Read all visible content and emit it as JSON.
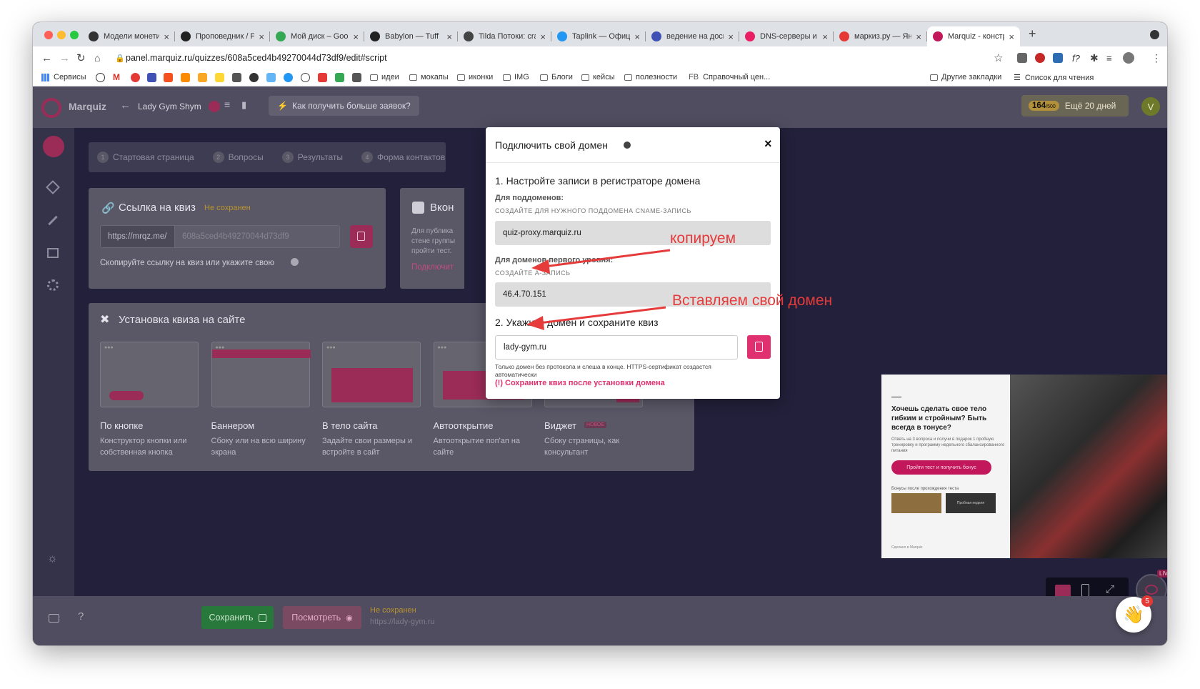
{
  "browser": {
    "tabs": [
      {
        "title": "Модели монетиза",
        "icon": "tab-favicon"
      },
      {
        "title": "Проповедник / Pr",
        "icon": "tab-favicon"
      },
      {
        "title": "Мой диск – Googl",
        "icon": "drive-icon"
      },
      {
        "title": "Babylon — Tuff",
        "icon": "youtube-icon"
      },
      {
        "title": "Tilda Потоки: craf",
        "icon": "tab-favicon"
      },
      {
        "title": "Taplink — Офици",
        "icon": "tab-favicon"
      },
      {
        "title": "ведение на доске",
        "icon": "tab-favicon"
      },
      {
        "title": "DNS-серверы и у",
        "icon": "tab-favicon"
      },
      {
        "title": "маркиз.ру — Янд",
        "icon": "yandex-icon"
      },
      {
        "title": "Marquiz - констру",
        "icon": "marquiz-icon"
      }
    ],
    "url": "panel.marquiz.ru/quizzes/608a5ced4b49270044d73df9/edit#script",
    "bookmarks": [
      "Сервисы",
      "идеи",
      "мокапы",
      "иконки",
      "IMG",
      "Блоги",
      "кейсы",
      "полезности",
      "Справочный цен..."
    ],
    "bookmarks_right": [
      "Другие закладки",
      "Список для чтения"
    ],
    "fb_label": "FB"
  },
  "app": {
    "logo": "Marquiz",
    "quiz_name": "Lady Gym Shym",
    "leads_link": "Как получить больше заявок?",
    "counter": "164",
    "counter_max": "/500",
    "days_left": "Ещё 20 дней",
    "avatar_letter": "V",
    "steps": [
      {
        "num": "1",
        "label": "Стартовая страница"
      },
      {
        "num": "2",
        "label": "Вопросы"
      },
      {
        "num": "3",
        "label": "Результаты"
      },
      {
        "num": "4",
        "label": "Форма контактов"
      }
    ],
    "link_card": {
      "title": "Ссылка на квиз",
      "status": "Не сохранен",
      "prefix": "https://mrqz.me/",
      "slug": "608a5ced4b49270044d73df9",
      "hint": "Скопируйте ссылку на квиз или укажите свою"
    },
    "vk_card": {
      "title": "Вкон",
      "text": "Для публика стене группы пройти тест.",
      "link": "Подключит"
    },
    "install": {
      "title": "Установка квиза на сайте",
      "options": [
        {
          "title": "По кнопке",
          "desc": "Конструктор кнопки или собственная кнопка",
          "badge": ""
        },
        {
          "title": "Баннером",
          "desc": "Сбоку или на всю ширину экрана",
          "badge": ""
        },
        {
          "title": "В тело сайта",
          "desc": "Задайте свои размеры и встройте в сайт",
          "badge": ""
        },
        {
          "title": "Автооткрытие",
          "desc": "Автооткрытие поп'ап на сайте",
          "badge": ""
        },
        {
          "title": "Виджет",
          "desc": "Сбоку страницы, как консультант",
          "badge": "НОВОЕ"
        }
      ]
    },
    "preview": {
      "headline": "Хочешь сделать свое тело гибким и стройным? Быть всегда в тонусе?",
      "sub": "Ответь на 3 вопроса и получи в подарок 1 пробную тренировку и программу недельного сбалансированного питания",
      "button": "Пройти тест и получить бонус",
      "bonus_label": "Бонусы после прохождения теста",
      "bonus2": "Пробная неделя",
      "footer": "Сделано в Marquiz"
    },
    "live_badge": "LIVE",
    "notif_count": "5",
    "bottom": {
      "save": "Сохранить",
      "preview": "Посмотреть",
      "status": "Не сохранен",
      "url": "https://lady-gym.ru",
      "help": "?"
    }
  },
  "modal": {
    "title": "Подключить свой домен",
    "close": "×",
    "step1": "1. Настройте записи в регистраторе домена",
    "sub_label": "Для поддоменов:",
    "sub_hint": "СОЗДАЙТЕ ДЛЯ НУЖНОГО ПОДДОМЕНА CNAME-ЗАПИСЬ",
    "cname_value": "quiz-proxy.marquiz.ru",
    "first_label": "Для доменов первого уровня:",
    "first_hint": "СОЗДАЙТЕ А-ЗАПИСЬ",
    "a_value": "46.4.70.151",
    "step2": "2. Укажите домен и сохраните квиз",
    "domain_value": "lady-gym.ru",
    "note": "Только домен без протокола и слеша в конце. HTTPS-сертификат создастся автоматически",
    "warning": "(!) Сохраните квиз после установки домена"
  },
  "annotations": {
    "copy": "копируем",
    "paste": "Вставляем свой домен"
  },
  "colors": {
    "accent": "#e0306f",
    "annotation": "#e53b3b",
    "save_green": "#27783a"
  }
}
